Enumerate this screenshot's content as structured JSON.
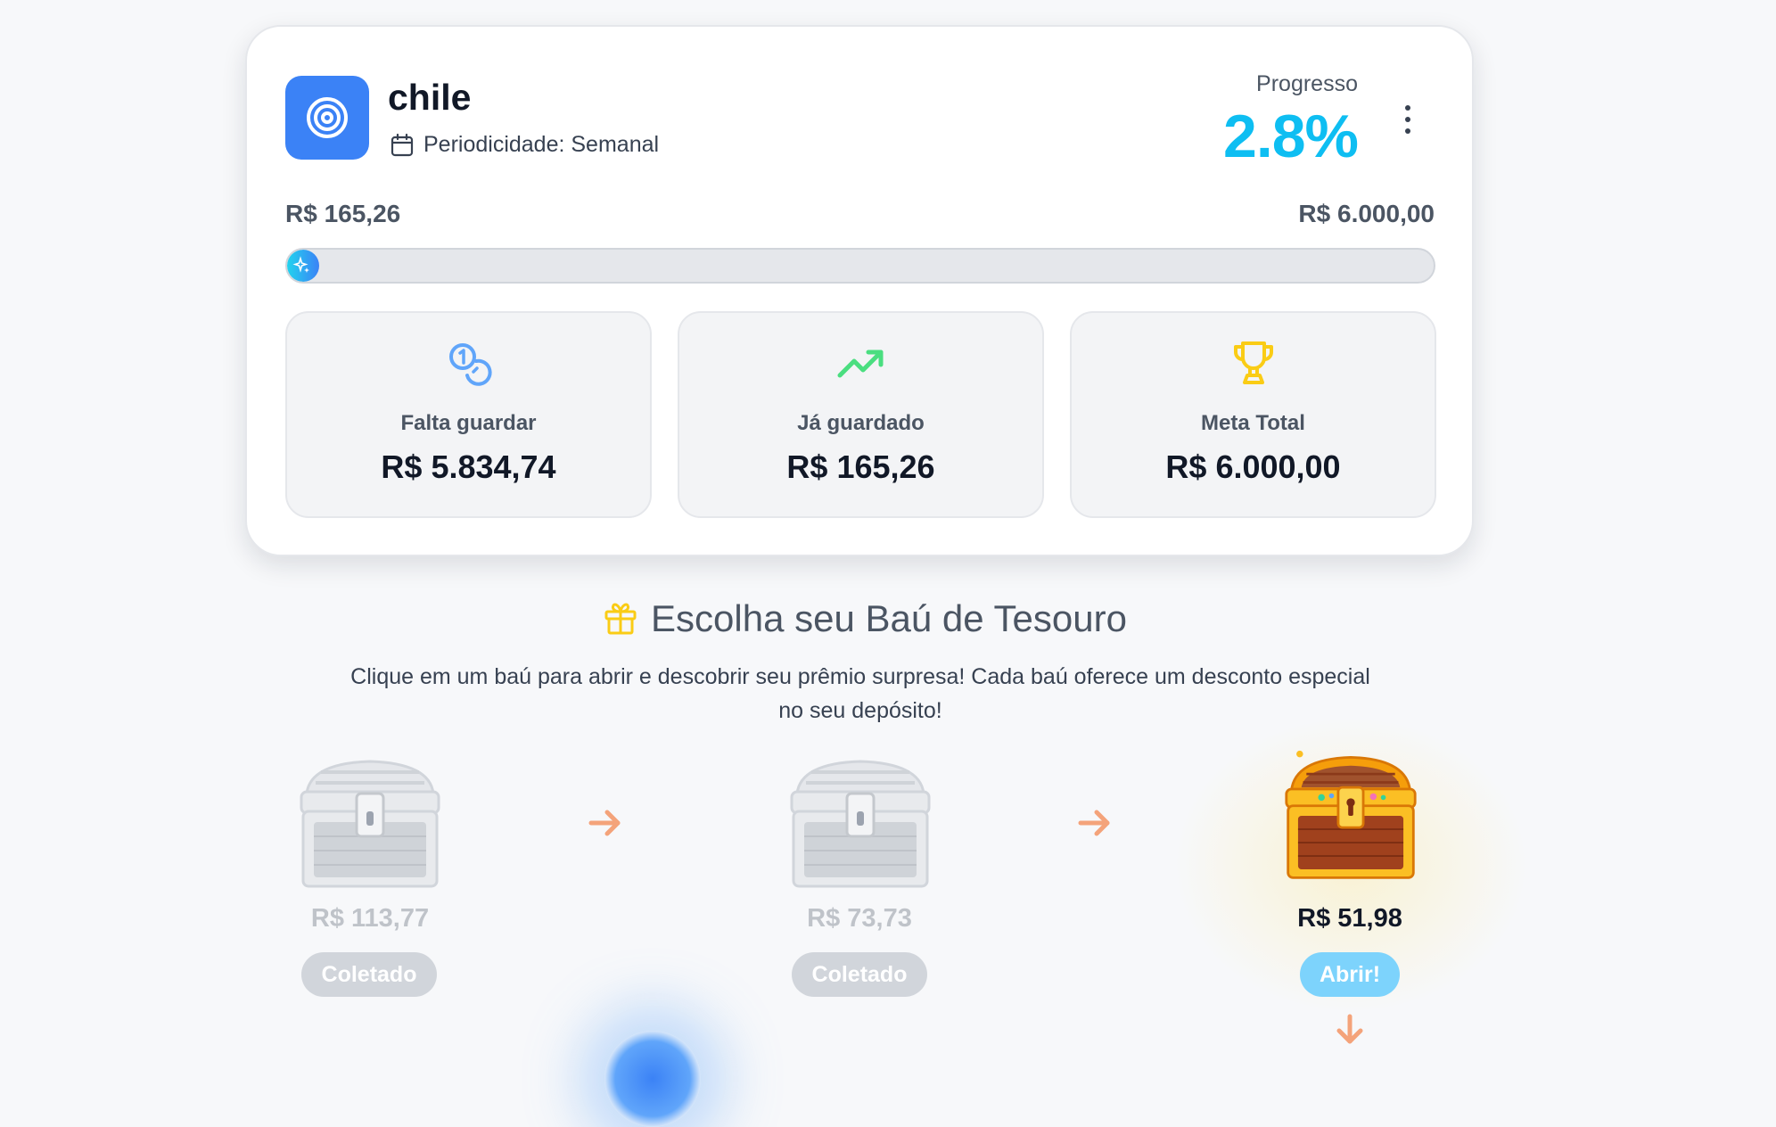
{
  "goal": {
    "title": "chile",
    "periodicity": "Periodicidade: Semanal",
    "progress_label": "Progresso",
    "progress_value": "2.8%",
    "progress_fraction": 0.028,
    "current_amount": "R$ 165,26",
    "target_amount": "R$ 6.000,00",
    "accent_color": "#0ebef2",
    "icon": "target-icon"
  },
  "stats": [
    {
      "label": "Falta guardar",
      "value": "R$ 5.834,74",
      "icon": "coins-icon",
      "color": "#60a5fa"
    },
    {
      "label": "Já guardado",
      "value": "R$ 165,26",
      "icon": "trending-up-icon",
      "color": "#4ade80"
    },
    {
      "label": "Meta Total",
      "value": "R$ 6.000,00",
      "icon": "trophy-icon",
      "color": "#facc15"
    }
  ],
  "treasure": {
    "title": "Escolha seu Baú de Tesouro",
    "description": "Clique em um baú para abrir e descobrir seu prêmio surpresa! Cada baú oferece um desconto especial no seu depósito!",
    "chests": [
      {
        "price": "R$ 113,77",
        "button": "Coletado",
        "state": "collected"
      },
      {
        "price": "R$ 73,73",
        "button": "Coletado",
        "state": "collected"
      },
      {
        "price": "R$ 51,98",
        "button": "Abrir!",
        "state": "available"
      }
    ]
  }
}
